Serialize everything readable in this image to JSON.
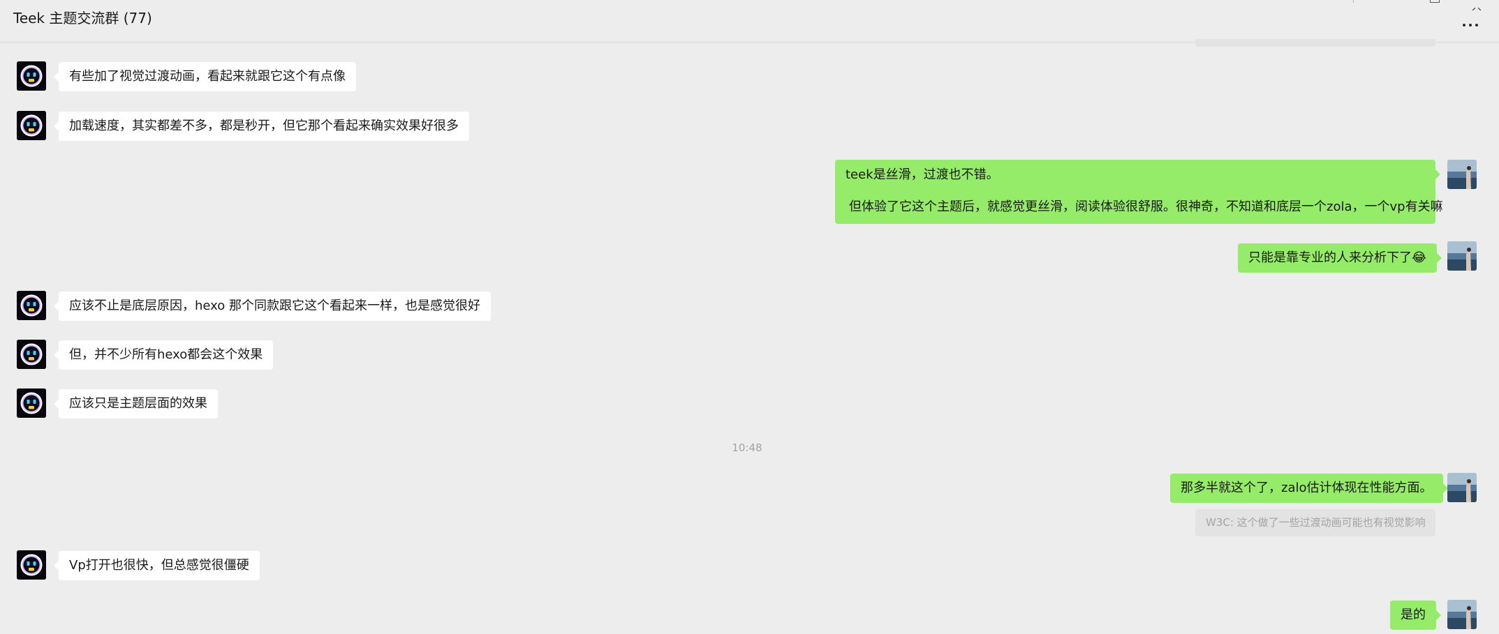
{
  "window": {
    "title": "Teek 主题交流群 (77)",
    "more_icon": "more-horizontal-icon"
  },
  "colors": {
    "background": "#ededed",
    "own_bubble": "#95ec69",
    "other_bubble": "#ffffff",
    "quote_background": "#e3e3e3",
    "meta_text": "#a3a3a3"
  },
  "messages": [
    {
      "side": "left",
      "lines": [
        "有些加了视觉过渡动画，看起来就跟它这个有点像"
      ]
    },
    {
      "side": "left",
      "lines": [
        "加载速度，其实都差不多，都是秒开，但它那个看起来确实效果好很多"
      ]
    },
    {
      "side": "right",
      "lines": [
        "teek是丝滑，过渡也不错。",
        "但体验了它这个主题后，就感觉更丝滑，阅读体验很舒服。很神奇，不知道和底层一个zola，一个vp有关嘛"
      ]
    },
    {
      "side": "right",
      "lines": [
        "只能是靠专业的人来分析下了😂"
      ]
    },
    {
      "side": "left",
      "lines": [
        "应该不止是底层原因，hexo 那个同款跟它这个看起来一样，也是感觉很好"
      ]
    },
    {
      "side": "left",
      "lines": [
        "但，并不少所有hexo都会这个效果"
      ]
    },
    {
      "side": "left",
      "lines": [
        "应该只是主题层面的效果"
      ]
    },
    {
      "side": "right",
      "lines": [
        "那多半就这个了，zalo估计体现在性能方面。"
      ]
    },
    {
      "side": "left",
      "lines": [
        "Vp打开也很快，但总感觉很僵硬"
      ]
    },
    {
      "side": "right",
      "lines": [
        "是的"
      ]
    }
  ],
  "time_separator": "10:48",
  "quote": "W3C: 这个做了一些过渡动画可能也有视觉影响"
}
